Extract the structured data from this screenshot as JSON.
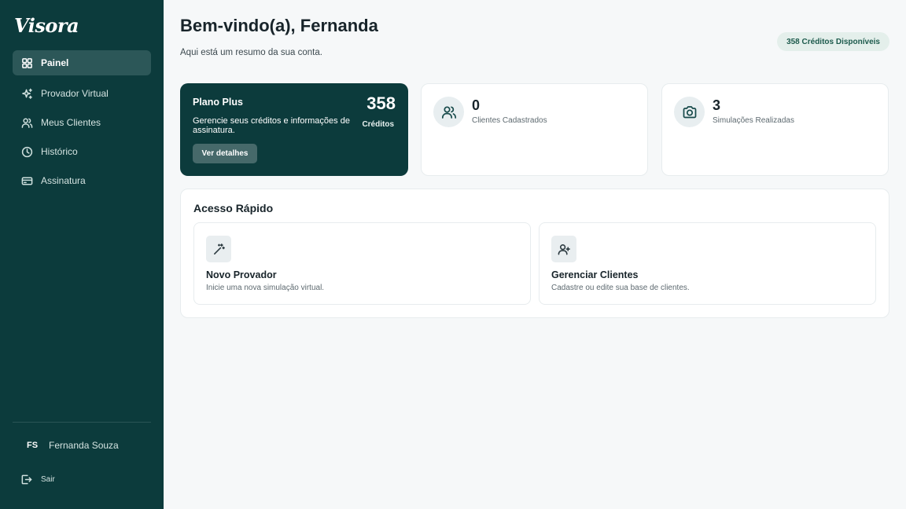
{
  "app": {
    "brand": "Visora"
  },
  "sidebar": {
    "items": [
      {
        "label": "Painel",
        "icon": "grid-icon",
        "active": true
      },
      {
        "label": "Provador Virtual",
        "icon": "sparkles-icon"
      },
      {
        "label": "Meus Clientes",
        "icon": "users-icon"
      },
      {
        "label": "Histórico",
        "icon": "clock-icon"
      },
      {
        "label": "Assinatura",
        "icon": "credit-card-icon"
      }
    ],
    "user": {
      "initials": "FS",
      "name": "Fernanda Souza"
    },
    "logout_label": "Sair"
  },
  "header": {
    "greeting": "Bem-vindo(a), Fernanda",
    "subtitle": "Aqui está um resumo da sua conta.",
    "credits_badge": "358 Créditos Disponíveis"
  },
  "plan": {
    "name": "Plano Plus",
    "description": "Gerencie seus créditos e informações de assinatura.",
    "button_label": "Ver detalhes",
    "credits_value": "358",
    "credits_label": "Créditos"
  },
  "stats": [
    {
      "value": "0",
      "label": "Clientes Cadastrados",
      "icon": "users-icon"
    },
    {
      "value": "3",
      "label": "Simulações Realizadas",
      "icon": "camera-icon"
    }
  ],
  "quick_access": {
    "title": "Acesso Rápido",
    "items": [
      {
        "title": "Novo Provador",
        "description": "Inicie uma nova simulação virtual.",
        "icon": "magic-wand-icon"
      },
      {
        "title": "Gerenciar Clientes",
        "description": "Cadastre ou edite sua base de clientes.",
        "icon": "user-plus-icon"
      }
    ]
  },
  "colors": {
    "sidebar_bg": "#0c3b3c",
    "accent": "#0c3b3c",
    "badge_bg": "#e4efeb",
    "badge_text": "#1c5a4c",
    "page_bg": "#f6f8f9"
  }
}
